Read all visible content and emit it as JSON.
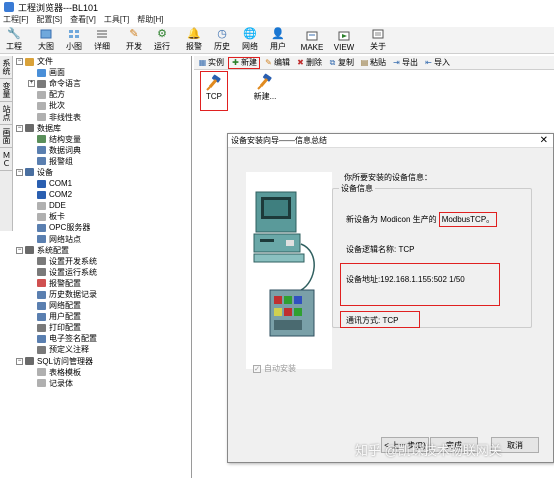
{
  "window": {
    "title": "工程浏览器---BL101"
  },
  "menu": [
    "工程[F]",
    "配置[S]",
    "查看[V]",
    "工具[T]",
    "帮助[H]"
  ],
  "toolbar": [
    {
      "label": "工程",
      "icon": "wrench-icon"
    },
    {
      "label": "大图",
      "icon": "large-icons-icon"
    },
    {
      "label": "小图",
      "icon": "small-icons-icon"
    },
    {
      "label": "详细",
      "icon": "details-icon"
    },
    {
      "label": "开发",
      "icon": "develop-icon"
    },
    {
      "label": "运行",
      "icon": "run-icon"
    },
    {
      "label": "报警",
      "icon": "alarm-icon"
    },
    {
      "label": "历史",
      "icon": "history-icon"
    },
    {
      "label": "网络",
      "icon": "network-icon"
    },
    {
      "label": "用户",
      "icon": "user-icon"
    },
    {
      "label": "MAKE",
      "icon": "make-icon"
    },
    {
      "label": "VIEW",
      "icon": "view-icon"
    },
    {
      "label": "关于",
      "icon": "about-icon"
    }
  ],
  "left_tabs": [
    "系统",
    "变量",
    "站点",
    "画面",
    "ＭＣ"
  ],
  "tree": [
    {
      "label": "文件",
      "level": 0,
      "expander": "−",
      "color": "#d9a23a"
    },
    {
      "label": "画面",
      "level": 1,
      "expander": "",
      "color": "#4a8fd8"
    },
    {
      "label": "命令语言",
      "level": 1,
      "expander": "+",
      "color": "#7a7a7a"
    },
    {
      "label": "配方",
      "level": 1,
      "expander": "",
      "color": "#b0b0b0"
    },
    {
      "label": "批次",
      "level": 1,
      "expander": "",
      "color": "#b0b0b0"
    },
    {
      "label": "非线性表",
      "level": 1,
      "expander": "",
      "color": "#b0b0b0"
    },
    {
      "label": "数据库",
      "level": 0,
      "expander": "−",
      "color": "#6a6a6a"
    },
    {
      "label": "结构变量",
      "level": 1,
      "expander": "",
      "color": "#5a8f5a"
    },
    {
      "label": "数据词典",
      "level": 1,
      "expander": "",
      "color": "#5a7fb0"
    },
    {
      "label": "报警组",
      "level": 1,
      "expander": "",
      "color": "#5a7fb0"
    },
    {
      "label": "设备",
      "level": 0,
      "expander": "−",
      "color": "#4a6fa0"
    },
    {
      "label": "COM1",
      "level": 1,
      "expander": "",
      "color": "#2a5fb0"
    },
    {
      "label": "COM2",
      "level": 1,
      "expander": "",
      "color": "#2a5fb0"
    },
    {
      "label": "DDE",
      "level": 1,
      "expander": "",
      "color": "#b0b0b0"
    },
    {
      "label": "板卡",
      "level": 1,
      "expander": "",
      "color": "#b0b0b0"
    },
    {
      "label": "OPC服务器",
      "level": 1,
      "expander": "",
      "color": "#5a7fb0"
    },
    {
      "label": "网络站点",
      "level": 1,
      "expander": "",
      "color": "#5a7fb0"
    },
    {
      "label": "系统配置",
      "level": 0,
      "expander": "−",
      "color": "#6a6a6a"
    },
    {
      "label": "设置开发系统",
      "level": 1,
      "expander": "",
      "color": "#7a7a7a"
    },
    {
      "label": "设置运行系统",
      "level": 1,
      "expander": "",
      "color": "#7a7a7a"
    },
    {
      "label": "报警配置",
      "level": 1,
      "expander": "",
      "color": "#d05050"
    },
    {
      "label": "历史数据记录",
      "level": 1,
      "expander": "",
      "color": "#5a7fb0"
    },
    {
      "label": "网络配置",
      "level": 1,
      "expander": "",
      "color": "#5a7fb0"
    },
    {
      "label": "用户配置",
      "level": 1,
      "expander": "",
      "color": "#5a7fb0"
    },
    {
      "label": "打印配置",
      "level": 1,
      "expander": "",
      "color": "#7a7a7a"
    },
    {
      "label": "电子签名配置",
      "level": 1,
      "expander": "",
      "color": "#5a7fb0"
    },
    {
      "label": "预定义注释",
      "level": 1,
      "expander": "",
      "color": "#7a7a7a"
    },
    {
      "label": "SQL访问管理器",
      "level": 0,
      "expander": "−",
      "color": "#6a6a6a"
    },
    {
      "label": "表格模板",
      "level": 1,
      "expander": "",
      "color": "#b0b0b0"
    },
    {
      "label": "记录体",
      "level": 1,
      "expander": "",
      "color": "#b0b0b0"
    }
  ],
  "subtoolbar": [
    {
      "label": "实例",
      "icon": "instance-icon"
    },
    {
      "label": "新建",
      "icon": "new-icon"
    },
    {
      "label": "编辑",
      "icon": "edit-icon"
    },
    {
      "label": "删除",
      "icon": "delete-icon"
    },
    {
      "label": "复制",
      "icon": "copy-icon"
    },
    {
      "label": "粘贴",
      "icon": "paste-icon"
    },
    {
      "label": "导出",
      "icon": "export-icon"
    },
    {
      "label": "导入",
      "icon": "import-icon"
    }
  ],
  "devices": [
    {
      "label": "TCP"
    },
    {
      "label": "新建..."
    }
  ],
  "dialog": {
    "title": "设备安装向导——信息总结",
    "close": "✕",
    "intro": "你所要安装的设备信息：",
    "group_label": "设备信息",
    "device_prefix": "新设备为 Modicon 生产的",
    "device_model": "ModbusTCP",
    "device_suffix": "。",
    "logical_name": "设备逻辑名称: TCP",
    "address": "设备地址:192.168.1.155:502 1/50",
    "comm_mode": "通讯方式:   TCP",
    "auto_install": "自动安装",
    "btn_back": "< 上一步(B)",
    "btn_finish": "完成",
    "btn_cancel": "取消"
  },
  "watermark": "知乎 @凯琛技术物联网关"
}
